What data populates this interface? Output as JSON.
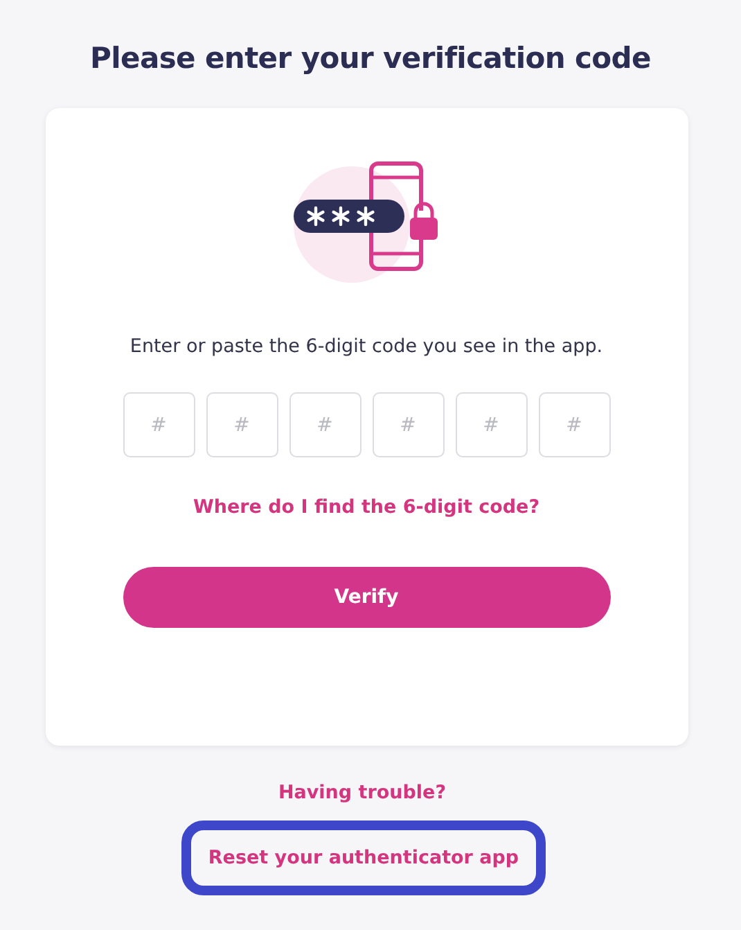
{
  "title": "Please enter your verification code",
  "card": {
    "instruction": "Enter or paste the 6-digit code you see in the app.",
    "code_inputs": [
      {
        "placeholder": "#"
      },
      {
        "placeholder": "#"
      },
      {
        "placeholder": "#"
      },
      {
        "placeholder": "#"
      },
      {
        "placeholder": "#"
      },
      {
        "placeholder": "#"
      }
    ],
    "help_link": "Where do I find the 6-digit code?",
    "verify_button": "Verify"
  },
  "trouble_text": "Having trouble?",
  "reset_button": {
    "label": "Reset your authenticator app",
    "focused": true
  }
}
